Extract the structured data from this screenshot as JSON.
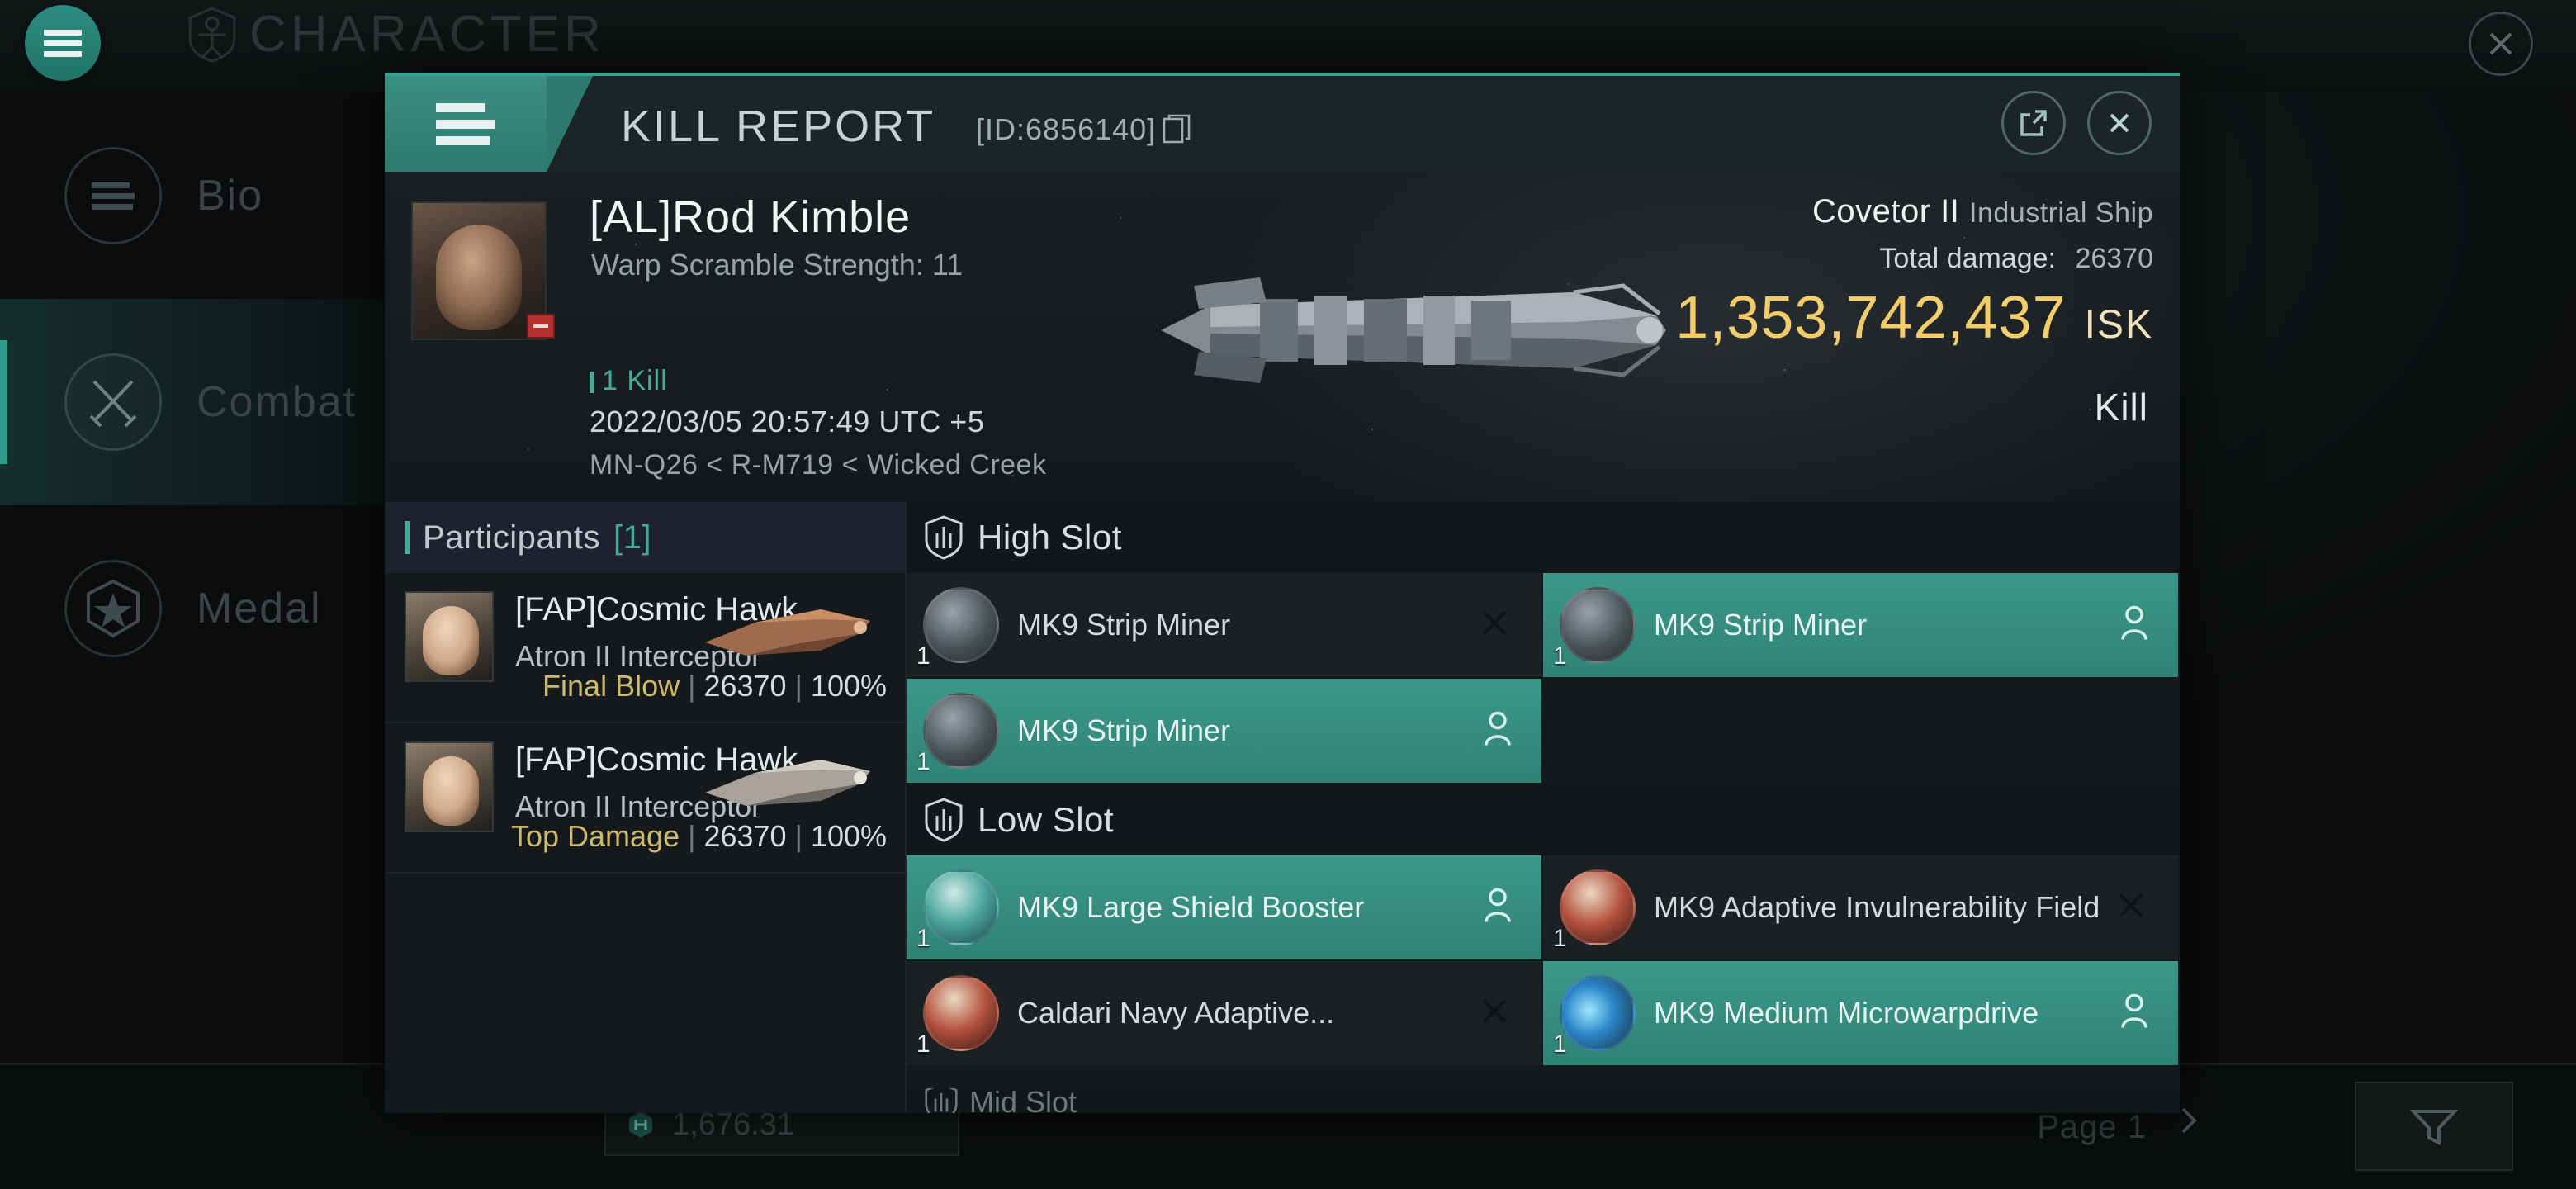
{
  "background": {
    "app_title": "CHARACTER",
    "menu_icon": "hamburger-icon",
    "close_icon": "close-icon",
    "sidebar": [
      {
        "label": "Bio",
        "icon": "list-icon",
        "active": false
      },
      {
        "label": "Combat",
        "icon": "crossed-swords-icon",
        "active": true
      },
      {
        "label": "Medal",
        "icon": "star-badge-icon",
        "active": false
      }
    ],
    "bottom": {
      "wallet_value": "1,676.31",
      "wallet_icon": "isk-icon",
      "page_label": "Page 1",
      "next_icon": "chevron-right-icon",
      "filter_icon": "filter-icon"
    }
  },
  "modal": {
    "menu_icon": "hamburger-icon",
    "title": "KILL REPORT",
    "id_label": "[ID:6856140]",
    "copy_icon": "copy-icon",
    "share_icon": "external-link-icon",
    "close_icon": "close-icon",
    "hero": {
      "victim_name": "[AL]Rod Kimble",
      "victim_sub": "Warp Scramble Strength: 11",
      "kill_count": "1 Kill",
      "timestamp": "2022/03/05 20:57:49 UTC +5",
      "location": "MN-Q26 < R-M719 < Wicked Creek",
      "ship_name": "Covetor II",
      "ship_class": "Industrial Ship",
      "total_damage_label": "Total damage:",
      "total_damage_value": "26370",
      "isk_value": "1,353,742,437",
      "isk_unit": "ISK",
      "result_tag": "Kill",
      "avatar_icon": "victim-portrait",
      "ship_art_icon": "ship-render"
    },
    "participants": {
      "header_label": "Participants",
      "header_count": "[1]",
      "rows": [
        {
          "name": "[FAP]Cosmic Hawk",
          "ship": "Atron II Interceptor",
          "tag": "Final Blow",
          "damage": "26370",
          "percent": "100%"
        },
        {
          "name": "[FAP]Cosmic Hawk",
          "ship": "Atron II Interceptor",
          "tag": "Top Damage",
          "damage": "26370",
          "percent": "100%"
        }
      ]
    },
    "slot_sections": [
      {
        "label": "High Slot",
        "icon": "shield-slot-icon",
        "items": [
          {
            "name": "MK9 Strip Miner",
            "qty": "1",
            "state": "destroyed",
            "state_icon": "x-icon",
            "art": "module"
          },
          {
            "name": "MK9 Strip Miner",
            "qty": "1",
            "state": "dropped",
            "state_icon": "person-icon",
            "art": "module"
          },
          {
            "name": "MK9 Strip Miner",
            "qty": "1",
            "state": "dropped",
            "state_icon": "person-icon",
            "art": "module"
          },
          {
            "name": "",
            "qty": "",
            "state": "empty",
            "state_icon": "",
            "art": ""
          }
        ]
      },
      {
        "label": "Low Slot",
        "icon": "shield-slot-icon",
        "items": [
          {
            "name": "MK9 Large Shield Booster",
            "qty": "1",
            "state": "dropped",
            "state_icon": "person-icon",
            "art": "shield"
          },
          {
            "name": "MK9 Adaptive Invulnerability Field",
            "qty": "1",
            "state": "destroyed",
            "state_icon": "x-icon",
            "art": "armor"
          },
          {
            "name": "Caldari Navy Adaptive...",
            "qty": "1",
            "state": "destroyed",
            "state_icon": "x-icon",
            "art": "armor"
          },
          {
            "name": "MK9 Medium Microwarpdrive",
            "qty": "1",
            "state": "dropped",
            "state_icon": "person-icon",
            "art": "mwd"
          }
        ]
      }
    ],
    "next_section_peek": "Mid Slot"
  },
  "colors": {
    "accent_teal": "#3aa294",
    "isk_gold": "#f2cd6a",
    "tag_gold": "#cdbb6a",
    "panel_dark": "#14191a",
    "dropped_green": "#3b988a"
  }
}
